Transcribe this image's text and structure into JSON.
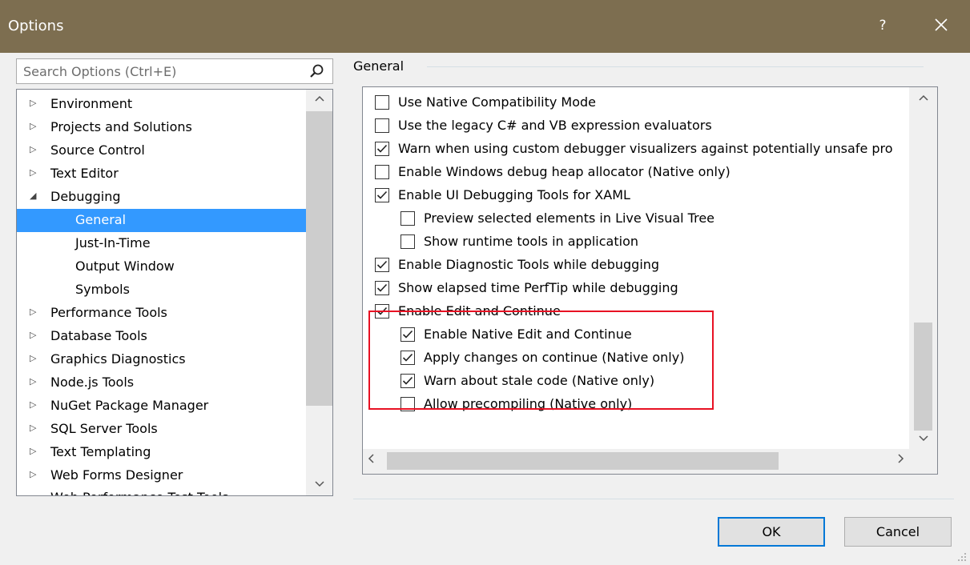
{
  "window": {
    "title": "Options",
    "help_label": "?",
    "close_icon": "close-icon"
  },
  "search": {
    "placeholder": "Search Options (Ctrl+E)",
    "icon": "search-icon"
  },
  "tree": {
    "items": [
      {
        "label": "Environment",
        "expander": "▷"
      },
      {
        "label": "Projects and Solutions",
        "expander": "▷"
      },
      {
        "label": "Source Control",
        "expander": "▷"
      },
      {
        "label": "Text Editor",
        "expander": "▷"
      },
      {
        "label": "Debugging",
        "expander": "◢"
      },
      {
        "label": "General"
      },
      {
        "label": "Just-In-Time"
      },
      {
        "label": "Output Window"
      },
      {
        "label": "Symbols"
      },
      {
        "label": "Performance Tools",
        "expander": "▷"
      },
      {
        "label": "Database Tools",
        "expander": "▷"
      },
      {
        "label": "Graphics Diagnostics",
        "expander": "▷"
      },
      {
        "label": "Node.js Tools",
        "expander": "▷"
      },
      {
        "label": "NuGet Package Manager",
        "expander": "▷"
      },
      {
        "label": "SQL Server Tools",
        "expander": "▷"
      },
      {
        "label": "Text Templating",
        "expander": "▷"
      },
      {
        "label": "Web Forms Designer",
        "expander": "▷"
      },
      {
        "label": "Web Performance Test Tools",
        "expander": "▷"
      }
    ],
    "selected": "General",
    "scroll_up": "^",
    "scroll_down": "v"
  },
  "section": {
    "title": "General"
  },
  "options": {
    "items": [
      {
        "label": "Use Native Compatibility Mode",
        "checked": false
      },
      {
        "label": "Use the legacy C# and VB expression evaluators",
        "checked": false
      },
      {
        "label": "Warn when using custom debugger visualizers against potentially unsafe pro",
        "checked": true
      },
      {
        "label": "Enable Windows debug heap allocator (Native only)",
        "checked": false
      },
      {
        "label": "Enable UI Debugging Tools for XAML",
        "checked": true
      },
      {
        "label": "Preview selected elements in Live Visual Tree",
        "checked": false
      },
      {
        "label": "Show runtime tools in application",
        "checked": false
      },
      {
        "label": "Enable Diagnostic Tools while debugging",
        "checked": true
      },
      {
        "label": "Show elapsed time PerfTip while debugging",
        "checked": true
      },
      {
        "label": "Enable Edit and Continue",
        "checked": true
      },
      {
        "label": "Enable Native Edit and Continue",
        "checked": true
      },
      {
        "label": "Apply changes on continue (Native only)",
        "checked": true
      },
      {
        "label": "Warn about stale code (Native only)",
        "checked": true
      },
      {
        "label": "Allow precompiling (Native only)",
        "checked": false
      }
    ],
    "scroll_up": "^",
    "scroll_down": "v",
    "scroll_left": "<",
    "scroll_right": ">"
  },
  "buttons": {
    "ok": "OK",
    "cancel": "Cancel"
  },
  "colors": {
    "titlebar": "#7d6e50",
    "selection": "#3399ff",
    "highlight_border": "#e81123",
    "default_button_border": "#0078d7"
  }
}
